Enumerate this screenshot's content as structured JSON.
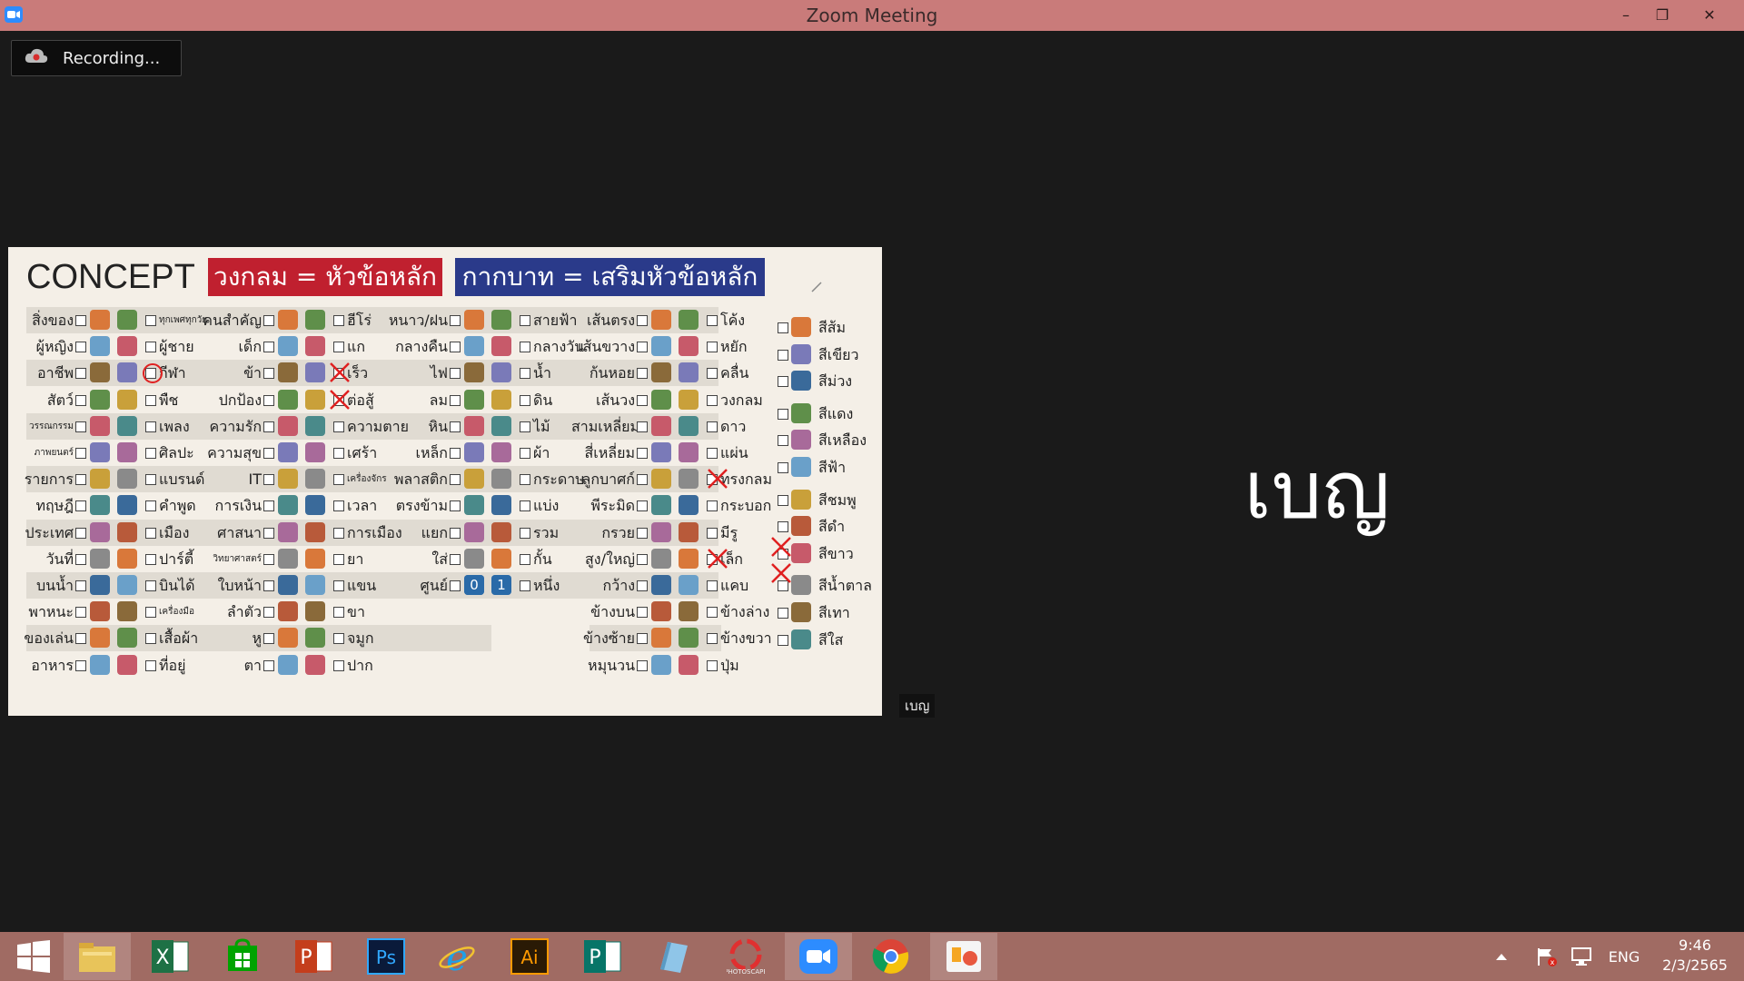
{
  "window": {
    "title": "Zoom Meeting",
    "minimize": "–",
    "restore": "❐",
    "close": "✕"
  },
  "recording": {
    "label": "Recording..."
  },
  "slide": {
    "title": "CONCEPT",
    "legend_circle": "วงกลม = หัวข้อหลัก",
    "legend_cross": "กากบาท = เสริมหัวข้อหลัก",
    "col1_left": [
      "สิ่งของ",
      "ผู้หญิง",
      "อาชีพ",
      "สัตว์",
      "วรรณกรรม",
      "ภาพยนตร์",
      "รายการ",
      "ทฤษฎี",
      "ประเทศ",
      "วันที่",
      "บนน้ำ",
      "พาหนะ",
      "ของเล่น",
      "อาหาร"
    ],
    "col1_right": [
      "ทุกเพศทุกวัย",
      "ผู้ชาย",
      "กีฬา",
      "พืช",
      "เพลง",
      "ศิลปะ",
      "แบรนด์",
      "คำพูด",
      "เมือง",
      "ปาร์ตี้",
      "บินได้",
      "เครื่องมือ",
      "เสื้อผ้า",
      "ที่อยู่"
    ],
    "col2_left": [
      "คนสำคัญ",
      "เด็ก",
      "ข้า",
      "ปกป้อง",
      "ความรัก",
      "ความสุข",
      "IT",
      "การเงิน",
      "ศาสนา",
      "วิทยาศาสตร์",
      "ใบหน้า",
      "ลำตัว",
      "หู",
      "ตา"
    ],
    "col2_right": [
      "ฮีโร่",
      "แก",
      "เร็ว",
      "ต่อสู้",
      "ความตาย",
      "เศร้า",
      "เครื่องจักร",
      "เวลา",
      "การเมือง",
      "ยา",
      "แขน",
      "ขา",
      "จมูก",
      "ปาก"
    ],
    "col3_left": [
      "หนาว/ฝน",
      "กลางคืน",
      "ไฟ",
      "ลม",
      "หิน",
      "เหล็ก",
      "พลาสติก",
      "ตรงข้าม",
      "แยก",
      "ใส่",
      "ศูนย์"
    ],
    "col3_right": [
      "สายฟ้า",
      "กลางวัน",
      "น้ำ",
      "ดิน",
      "ไม้",
      "ผ้า",
      "กระดาษ",
      "แบ่ง",
      "รวม",
      "กั้น",
      "หนึ่ง"
    ],
    "col4_left": [
      "เส้นตรง",
      "เส้นขวาง",
      "ก้นหอย",
      "เส้นวง",
      "สามเหลี่ยม",
      "สี่เหลี่ยม",
      "ลูกบาศก์",
      "พีระมิด",
      "กรวย",
      "สูง/ใหญ่",
      "กว้าง",
      "ข้างบน",
      "ข้างซ้าย",
      "หมุนวน"
    ],
    "col4_right": [
      "โค้ง",
      "หยัก",
      "คลื่น",
      "วงกลม",
      "ดาว",
      "แผ่น",
      "ทรงกลม",
      "กระบอก",
      "มีรู",
      "เล็ก",
      "แคบ",
      "ข้างล่าง",
      "ข้างขวา",
      "ปุ่ม"
    ],
    "colors": [
      "สีส้ม",
      "สีเขียว",
      "สีม่วง",
      "สีแดง",
      "สีเหลือง",
      "สีฟ้า",
      "สีชมพู",
      "สีดำ",
      "สีขาว",
      "สีน้ำตาล",
      "สีเทา",
      "สีใส"
    ],
    "digit_zero": "0",
    "digit_one": "1"
  },
  "participant": {
    "name": "เบญ",
    "tag": "เบญ"
  },
  "taskbar": {
    "apps": [
      "start",
      "file-explorer",
      "excel",
      "store",
      "powerpoint",
      "photoshop",
      "internet-explorer",
      "illustrator",
      "publisher",
      "notepad",
      "photoscape",
      "zoom",
      "chrome",
      "photos"
    ],
    "lang": "ENG",
    "time": "9:46",
    "date": "2/3/2565"
  },
  "colors": {
    "titlebar": "#c97b7a",
    "taskbar": "#a06b63",
    "red_legend": "#c0202f",
    "blue_legend": "#2a3a8a",
    "slide_bg": "#f4efe7"
  }
}
